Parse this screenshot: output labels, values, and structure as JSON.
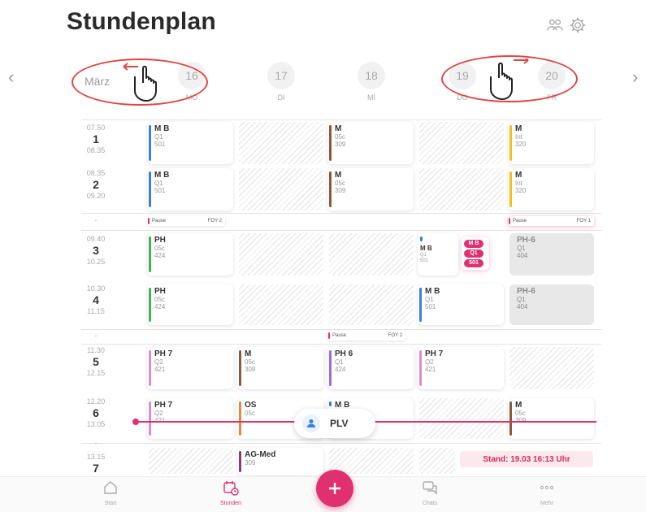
{
  "header": {
    "title": "Stundenplan",
    "icons": [
      "people-icon",
      "gear-icon"
    ]
  },
  "nav": {
    "prev": "‹",
    "next": "›",
    "month": "März"
  },
  "days": [
    {
      "num": "16",
      "label": "MO"
    },
    {
      "num": "17",
      "label": "DI"
    },
    {
      "num": "18",
      "label": "MI"
    },
    {
      "num": "19",
      "label": "DO"
    },
    {
      "num": "20",
      "label": "FR"
    }
  ],
  "periods": [
    {
      "start": "07.50",
      "num": "1",
      "end": "08.35"
    },
    {
      "start": "08.35",
      "num": "2",
      "end": "09.20"
    },
    {
      "start": "09.40",
      "num": "3",
      "end": "10.25"
    },
    {
      "start": "10.30",
      "num": "4",
      "end": "11.15"
    },
    {
      "start": "11.30",
      "num": "5",
      "end": "12.15"
    },
    {
      "start": "12.20",
      "num": "6",
      "end": "13.05"
    },
    {
      "start": "13.15",
      "num": "7",
      "end": ""
    }
  ],
  "breaks": [
    "-",
    "-",
    "-"
  ],
  "lessons": {
    "p1mo": {
      "s": "M B",
      "c": "Q1",
      "r": "501"
    },
    "p1mi": {
      "s": "M",
      "c": "05c",
      "r": "309"
    },
    "p1fr": {
      "s": "M",
      "c": "Int",
      "r": "320"
    },
    "p2mo": {
      "s": "M B",
      "c": "Q1",
      "r": "501"
    },
    "p2mi": {
      "s": "M",
      "c": "05c",
      "r": "309"
    },
    "p2fr": {
      "s": "M",
      "c": "Int",
      "r": "320"
    },
    "p3mo": {
      "s": "PH",
      "c": "05c",
      "r": "424"
    },
    "p3do": {
      "s": "M B",
      "c": "Q1",
      "r": "501"
    },
    "p3fr": {
      "s": "PH-6",
      "c": "Q1",
      "r": "404"
    },
    "p4mo": {
      "s": "PH",
      "c": "05c",
      "r": "424"
    },
    "p4do": {
      "s": "M B",
      "c": "Q1",
      "r": "501"
    },
    "p4fr": {
      "s": "PH-6",
      "c": "Q1",
      "r": "404"
    },
    "p5mo": {
      "s": "PH 7",
      "c": "Q2",
      "r": "421"
    },
    "p5di": {
      "s": "M",
      "c": "05c",
      "r": "309"
    },
    "p5mi": {
      "s": "PH 6",
      "c": "Q1",
      "r": "424"
    },
    "p5do": {
      "s": "PH 7",
      "c": "Q2",
      "r": "421"
    },
    "p6mo": {
      "s": "PH 7",
      "c": "Q2",
      "r": "421"
    },
    "p6di": {
      "s": "OS",
      "c": "05c",
      "r": ""
    },
    "p6mi": {
      "s": "M B",
      "c": "",
      "r": ""
    },
    "p6fr": {
      "s": "M",
      "c": "05c",
      "r": "309"
    },
    "p7di": {
      "s": "AG-Med",
      "c": "",
      "r": "309"
    }
  },
  "pill": {
    "s": "M B",
    "c": "Q1",
    "r": "501"
  },
  "pauses": [
    {
      "label": "Pause",
      "room": "FOY 2"
    },
    {
      "label": "Pause",
      "room": "FOY 1"
    },
    {
      "label": "Pause",
      "room": "FOY 2"
    }
  ],
  "plv": {
    "label": "PLV"
  },
  "stand": "Stand: 19.03 16:13 Uhr",
  "tabs": [
    {
      "label": "Start"
    },
    {
      "label": "Stunden"
    },
    {
      "label": "Chats"
    },
    {
      "label": "Mehr"
    }
  ],
  "colors": {
    "accent": "#e0306f",
    "blue": "#3a7fe0",
    "brown": "#8b5a3c",
    "yellow": "#f0c020",
    "green": "#3cb44b",
    "pink": "#e08ad6",
    "purple": "#9b6be0",
    "orange": "#e8883c",
    "annotation": "#e04545"
  }
}
